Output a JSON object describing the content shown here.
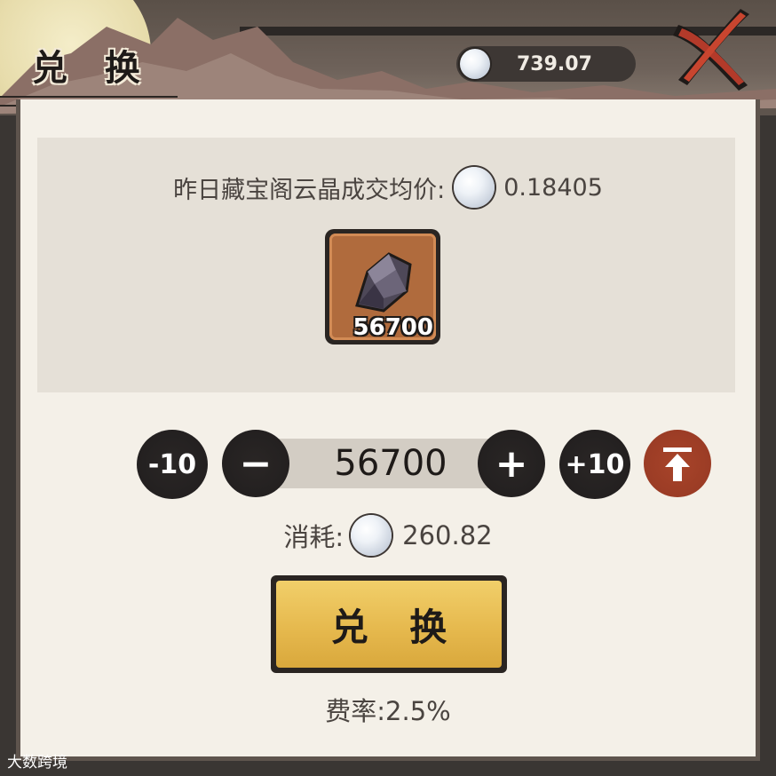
{
  "header": {
    "title": "兑 换",
    "currency_icon": "pearl-icon",
    "currency_balance": "739.07",
    "close_icon": "close-x-icon"
  },
  "price_info": {
    "label": "昨日藏宝阁云晶成交均价:",
    "icon": "pearl-icon",
    "value": "0.18405"
  },
  "item": {
    "icon": "crystal-ore-icon",
    "count": "56700"
  },
  "quantity": {
    "minus10_label": "-10",
    "minus_label": "−",
    "value": "56700",
    "plus_label": "+",
    "plus10_label": "+10",
    "max_icon": "max-arrow-icon"
  },
  "cost": {
    "label": "消耗:",
    "icon": "pearl-icon",
    "value": "260.82"
  },
  "exchange_button": {
    "label": "兑 换"
  },
  "fee": {
    "text": "费率:2.5%"
  },
  "watermark": {
    "text": "大数跨境"
  },
  "colors": {
    "panel_bg": "#f4f0e8",
    "info_box_bg": "#e5e0d7",
    "button_gold": "#e6b94e",
    "max_button_red": "#9b3c25",
    "ink_black": "#232020"
  }
}
